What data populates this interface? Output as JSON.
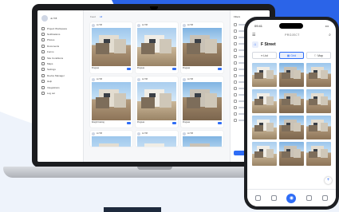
{
  "colors": {
    "accent": "#2f6df6",
    "background_blue": "#2b64e8",
    "badge": "#e5484d"
  },
  "laptop": {
    "sidebar": {
      "user_name": "Jo Tr8",
      "company": "",
      "items": [
        {
          "label": "Project Workspace",
          "icon": "folder-icon"
        },
        {
          "label": "Notifications",
          "icon": "bell-icon",
          "badge": ""
        },
        {
          "label": "Photos",
          "icon": "photo-icon"
        },
        {
          "label": "Documents",
          "icon": "document-icon"
        },
        {
          "label": "Forms",
          "icon": "form-icon"
        },
        {
          "label": "Site Conditions",
          "icon": "site-icon"
        },
        {
          "label": "Maps",
          "icon": "map-icon"
        },
        {
          "label": "Settings",
          "icon": "gear-icon"
        },
        {
          "label": "Device Manager",
          "icon": "device-icon"
        },
        {
          "label": "Help",
          "icon": "help-icon"
        },
        {
          "label": "Integrations",
          "icon": "plug-icon"
        },
        {
          "label": "Log out",
          "icon": "logout-icon"
        }
      ]
    },
    "main": {
      "tabs": [
        "Feed",
        "All"
      ],
      "cards": [
        {
          "user": "Jo Tr8",
          "tag": "Progress"
        },
        {
          "user": "Jo Tr8",
          "tag": "Progress"
        },
        {
          "user": "Jo Tr8",
          "tag": "Progress"
        },
        {
          "user": "Jo Tr8",
          "tag": "Rough Framing"
        },
        {
          "user": "Jo Tr8",
          "tag": "Progress"
        },
        {
          "user": "Jo Tr8",
          "tag": "Progress"
        },
        {
          "user": "Jo Tr8",
          "tag": ""
        },
        {
          "user": "Jo Tr8",
          "tag": ""
        },
        {
          "user": "Jo Tr8",
          "tag": ""
        }
      ]
    },
    "right_panel": {
      "title": "Filters"
    }
  },
  "phone": {
    "status": {
      "time": "09:41",
      "indicators": "•••"
    },
    "brand": "PROJECT",
    "project_name": "F Street",
    "tabs": [
      {
        "label": "List",
        "icon": "list-icon"
      },
      {
        "label": "Grid",
        "icon": "grid-icon"
      },
      {
        "label": "Map",
        "icon": "map-icon"
      }
    ],
    "fab": "+",
    "camera": "◉"
  }
}
